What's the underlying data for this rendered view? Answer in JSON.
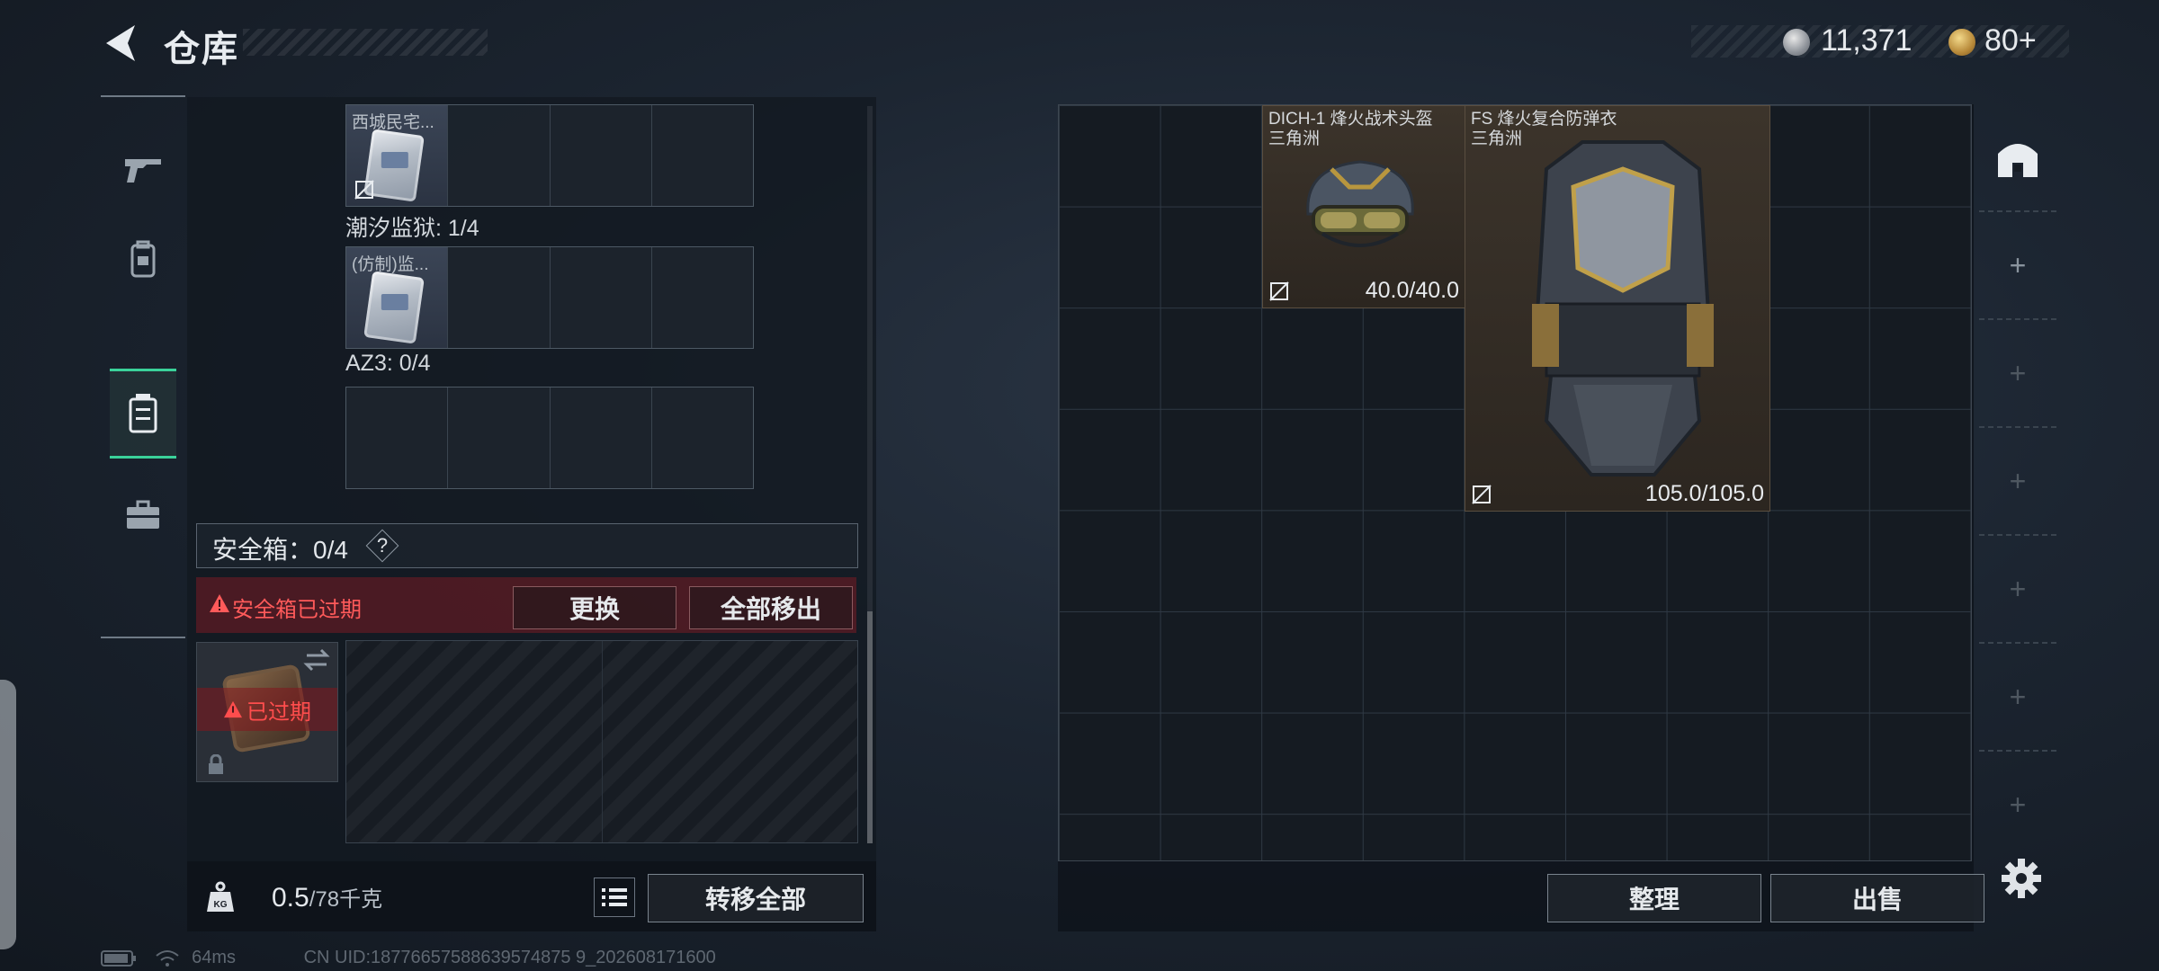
{
  "header": {
    "title": "仓库",
    "currency_silver": "11,371",
    "currency_gold": "80+"
  },
  "left_nav": {
    "items": [
      "weapon-icon",
      "backpack-icon",
      "safebox-icon",
      "toolbox-icon"
    ],
    "active_index": 2
  },
  "containers": [
    {
      "label": "",
      "item_name": "西城民宅..."
    },
    {
      "label": "潮汐监狱: 1/4",
      "item_name": "(仿制)监..."
    },
    {
      "label": "AZ3: 0/4",
      "item_name": ""
    }
  ],
  "safebox": {
    "label": "安全箱：0/4",
    "help": "?",
    "expired_message": "安全箱已过期",
    "replace_button": "更换",
    "remove_all_button": "全部移出",
    "expired_stamp": "已过期"
  },
  "footer_left": {
    "weight_value": "0.5",
    "weight_max": "/78千克",
    "transfer_all_button": "转移全部"
  },
  "stash": {
    "items": [
      {
        "name": "DICH-1 烽火战术头盔",
        "subtitle": "三角洲",
        "durability": "40.0/40.0"
      },
      {
        "name": "FS 烽火复合防弹衣",
        "subtitle": "三角洲",
        "durability": "105.0/105.0"
      }
    ],
    "sort_button": "整理",
    "sell_button": "出售"
  },
  "status": {
    "ping": "64ms",
    "uid": "CN UID:18776657588639574875 9_202608171600"
  },
  "colors": {
    "accent_green": "#3ad29a",
    "warning_red": "#ff5a5a"
  }
}
